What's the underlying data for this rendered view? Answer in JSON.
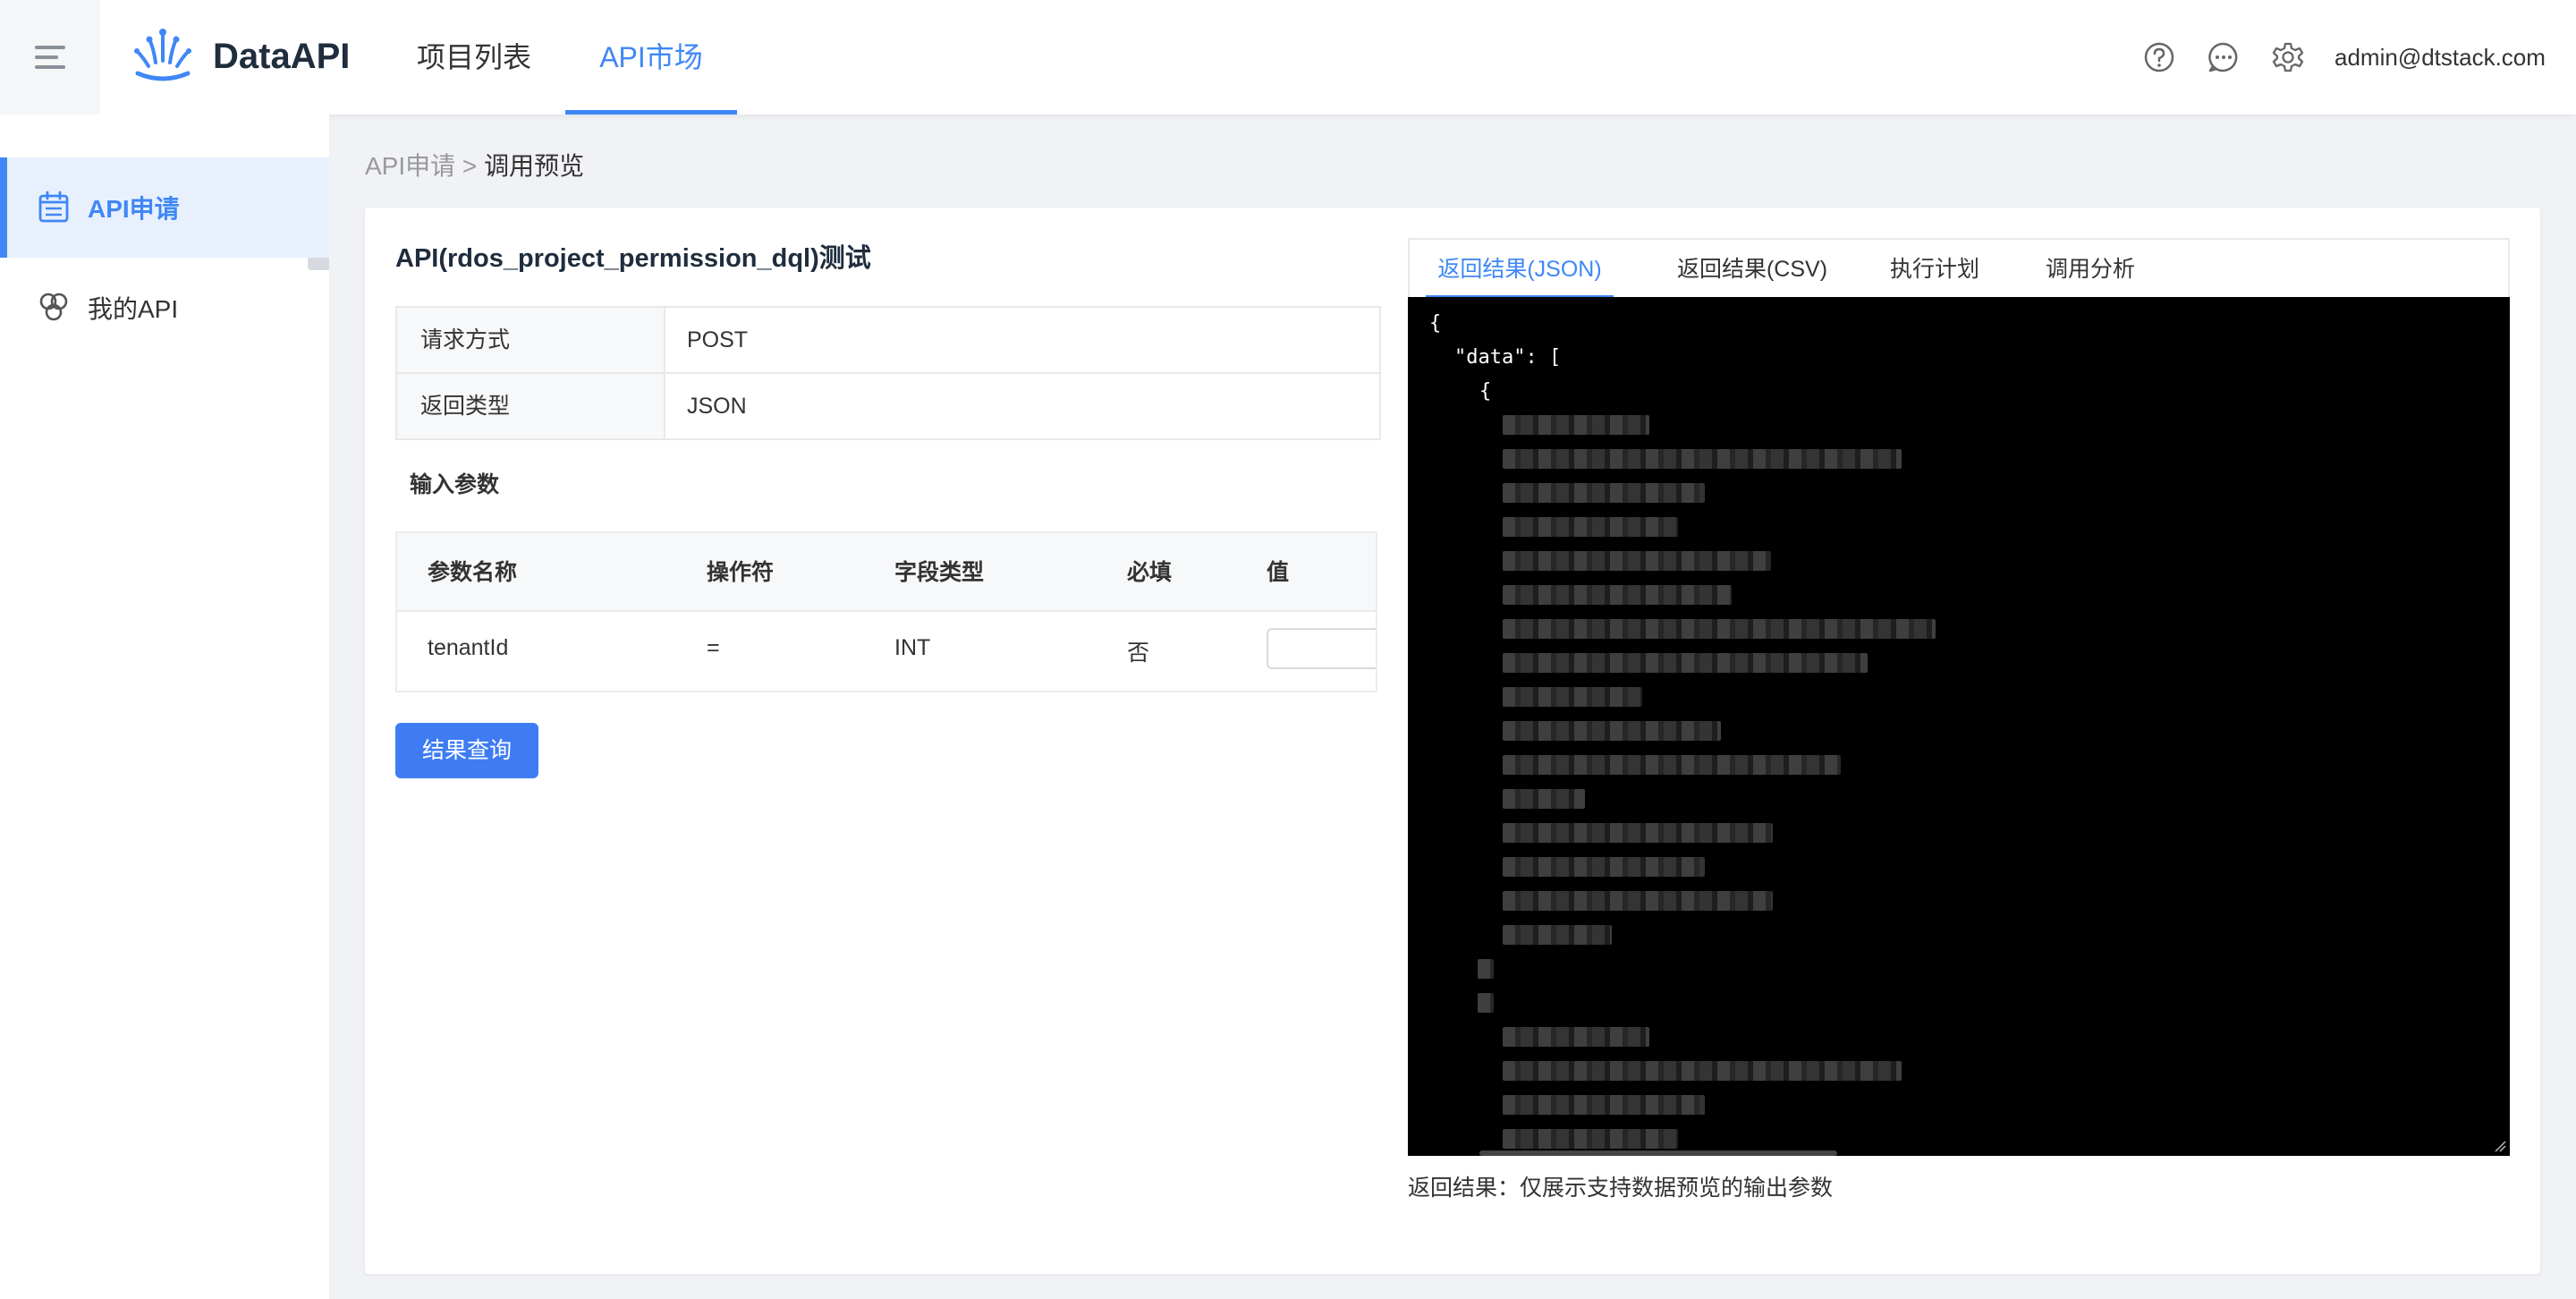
{
  "header": {
    "brand": "DataAPI",
    "nav": [
      "项目列表",
      "API市场"
    ],
    "active_nav": "API市场",
    "user": "admin@dtstack.com",
    "icons": [
      "help-icon",
      "message-icon",
      "settings-icon"
    ],
    "accent_color": "#3f87f5"
  },
  "sidebar": {
    "items": [
      {
        "label": "API申请",
        "icon": "calendar-icon",
        "active": true
      },
      {
        "label": "我的API",
        "icon": "cubes-icon",
        "active": false
      }
    ]
  },
  "breadcrumb": {
    "parent": "API申请",
    "separator": ">",
    "current": "调用预览"
  },
  "test": {
    "title": "API(rdos_project_permission_dql)测试",
    "info": [
      {
        "label": "请求方式",
        "value": "POST"
      },
      {
        "label": "返回类型",
        "value": "JSON"
      }
    ],
    "params_title": "输入参数",
    "param_headers": [
      "参数名称",
      "操作符",
      "字段类型",
      "必填",
      "值"
    ],
    "params": [
      {
        "name": "tenantId",
        "operator": "=",
        "type": "INT",
        "required": "否",
        "value": ""
      }
    ],
    "query_button": "结果查询"
  },
  "result": {
    "tabs": [
      "返回结果(JSON)",
      "返回结果(CSV)",
      "执行计划",
      "调用分析"
    ],
    "active_tab": "返回结果(JSON)",
    "json_lines": [
      "{",
      "\"data\": [",
      "{"
    ],
    "note": "返回结果：仅展示支持数据预览的输出参数"
  }
}
